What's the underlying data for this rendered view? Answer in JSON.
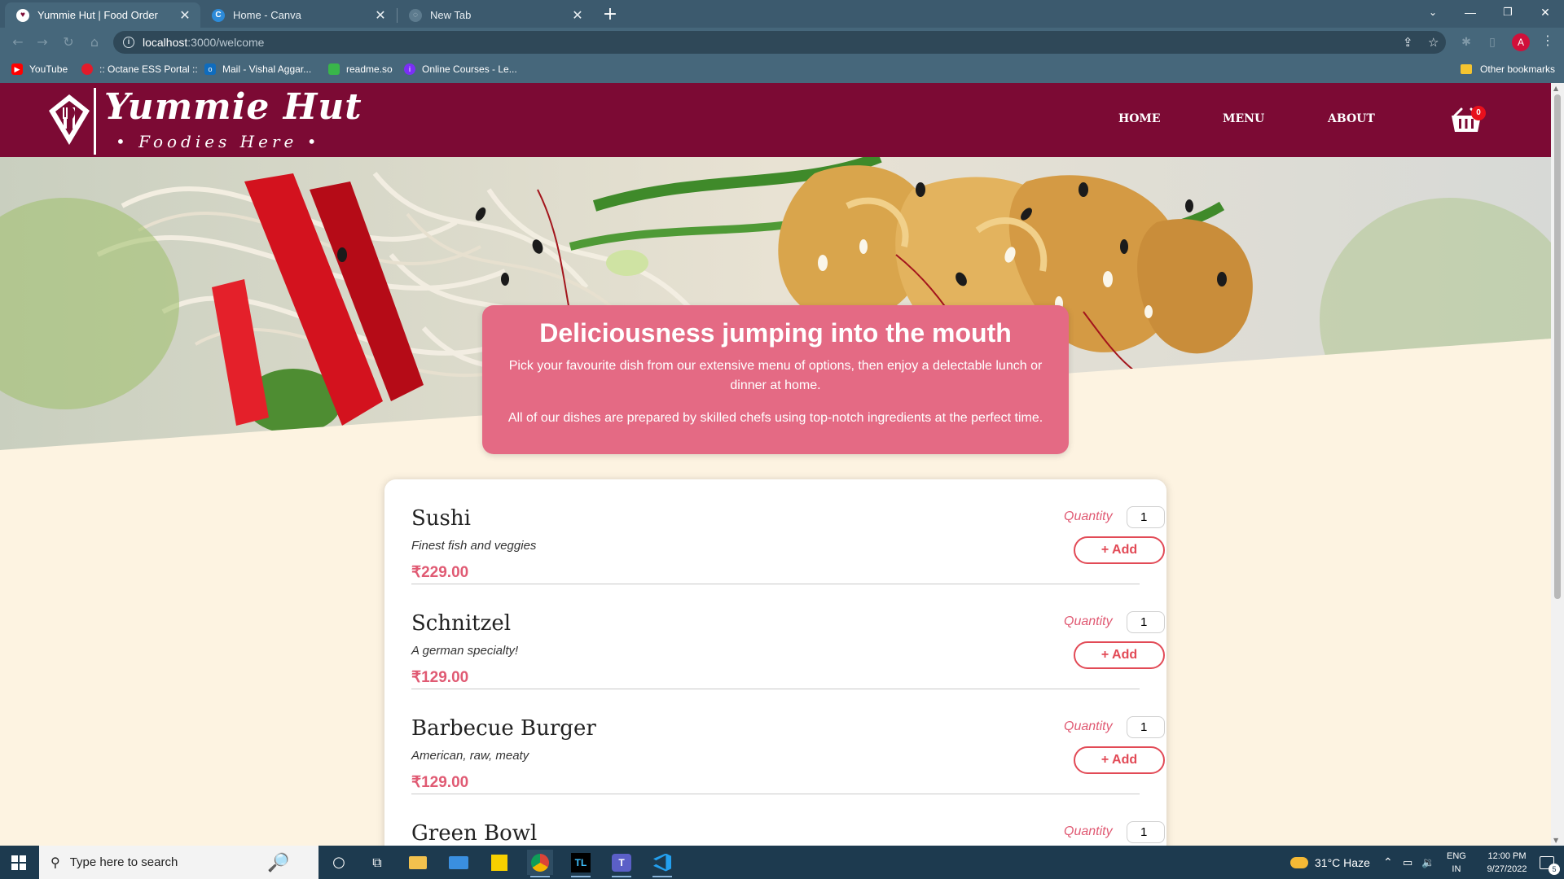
{
  "browser": {
    "tabs": [
      {
        "title": "Yummie Hut | Food Order",
        "active": true
      },
      {
        "title": "Home - Canva",
        "active": false
      },
      {
        "title": "New Tab",
        "active": false
      }
    ],
    "url_host": "localhost",
    "url_path": ":3000/welcome",
    "profile_initial": "A",
    "bookmarks": [
      {
        "label": "YouTube",
        "icon": "youtube-icon",
        "color": "#ff0000"
      },
      {
        "label": ":: Octane ESS Portal ::",
        "icon": "octane-icon",
        "color": "#e21b2b"
      },
      {
        "label": "Mail - Vishal Aggar...",
        "icon": "outlook-icon",
        "color": "#0f6cbd"
      },
      {
        "label": "readme.so",
        "icon": "readme-icon",
        "color": "#39b54a"
      },
      {
        "label": "Online Courses - Le...",
        "icon": "courses-icon",
        "color": "#7b2ff7"
      }
    ],
    "other_bookmarks": "Other bookmarks"
  },
  "site": {
    "brand": "Yummie Hut",
    "tagline": "• Foodies Here •",
    "nav": [
      "HOME",
      "MENU",
      "ABOUT"
    ],
    "cart_count": "0",
    "colors": {
      "header": "#7c0a34",
      "accent": "#e46a84",
      "price": "#e05a73",
      "background": "#fdf3e1"
    }
  },
  "summary": {
    "title": "Deliciousness jumping into the mouth",
    "para1": "Pick your favourite dish from our extensive menu of options, then enjoy a delectable lunch or dinner at home.",
    "para2": "All of our dishes are prepared by skilled chefs using top-notch ingredients at the perfect time."
  },
  "meals": {
    "quantity_label": "Quantity",
    "add_label": "+ Add",
    "items": [
      {
        "name": "Sushi",
        "description": "Finest fish and veggies",
        "price": "₹229.00",
        "qty": "1"
      },
      {
        "name": "Schnitzel",
        "description": "A german specialty!",
        "price": "₹129.00",
        "qty": "1"
      },
      {
        "name": "Barbecue Burger",
        "description": "American, raw, meaty",
        "price": "₹129.00",
        "qty": "1"
      },
      {
        "name": "Green Bowl",
        "description": "",
        "price": "",
        "qty": "1"
      }
    ]
  },
  "taskbar": {
    "search_placeholder": "Type here to search",
    "weather": "31°C  Haze",
    "lang_top": "ENG",
    "lang_bottom": "IN",
    "time": "12:00 PM",
    "date": "9/27/2022",
    "notifications": "5"
  }
}
